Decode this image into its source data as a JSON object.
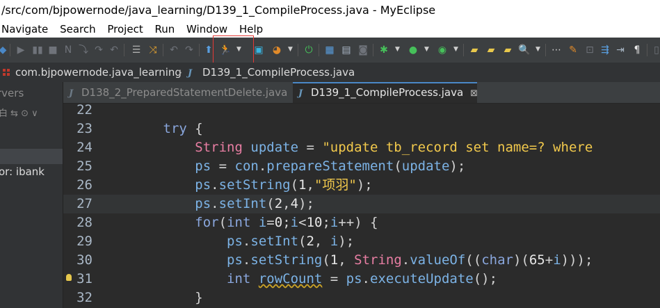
{
  "window": {
    "title": "/src/com/bjpowernode/java_learning/D139_1_CompileProcess.java - MyEclipse"
  },
  "menu": {
    "items": [
      "Navigate",
      "Search",
      "Project",
      "Run",
      "Window",
      "Help"
    ]
  },
  "toolbar": {
    "icons": [
      "step-into-icon",
      "resume-icon",
      "suspend-icon",
      "terminate-icon",
      "disconnect-icon",
      "step-over-icon",
      "step-return-icon",
      "drop-to-frame-icon",
      "use-step-filters-icon",
      "undo-icon",
      "redo-icon",
      "deploy-icon",
      "run-server-icon",
      "server-icon",
      "palette-icon",
      "power-icon",
      "layout-icon",
      "ui-designer-icon",
      "camera-icon",
      "debug-bug-icon",
      "run-icon",
      "run-external-icon",
      "open-folder-icon",
      "new-folder-icon",
      "open-file-icon",
      "search-icon",
      "mark-occurrences-icon",
      "pencil-icon",
      "next-annotation-icon",
      "toggle-wrap-icon",
      "show-whitespace-icon"
    ]
  },
  "breadcrumb": {
    "package": "com.bjpowernode.java_learning",
    "separator": "›",
    "file": "D139_1_CompileProcess.java"
  },
  "left_panel": {
    "tab_label": "rvers",
    "project_label": "or: ibank"
  },
  "tabs": [
    {
      "label": "D138_2_PreparedStatementDelete.java",
      "active": false
    },
    {
      "label": "D139_1_CompileProcess.java",
      "active": true
    }
  ],
  "editor": {
    "current_line": "27",
    "lines": [
      {
        "number": "22",
        "code": ""
      },
      {
        "number": "23",
        "code": "        try {"
      },
      {
        "number": "24",
        "code": "            String update = \"update tb_record set name=? where"
      },
      {
        "number": "25",
        "code": "            ps = con.prepareStatement(update);"
      },
      {
        "number": "26",
        "code": "            ps.setString(1,\"项羽\");"
      },
      {
        "number": "27",
        "code": "            ps.setInt(2,4);"
      },
      {
        "number": "28",
        "code": "            for(int i=0;i<10;i++) {"
      },
      {
        "number": "29",
        "code": "                ps.setInt(2, i);"
      },
      {
        "number": "30",
        "code": "                ps.setString(1, String.valueOf((char)(65+i)));"
      },
      {
        "number": "31",
        "code": "                int rowCount = ps.executeUpdate();"
      },
      {
        "number": "32",
        "code": "            }"
      }
    ]
  },
  "colors": {
    "editor_bg": "#2b2b2b",
    "keyword": "#8aa7de",
    "type": "#e87ea3",
    "string": "#f2c94c",
    "identifier": "#7cb3e6",
    "highlight_border": "#e53935"
  }
}
